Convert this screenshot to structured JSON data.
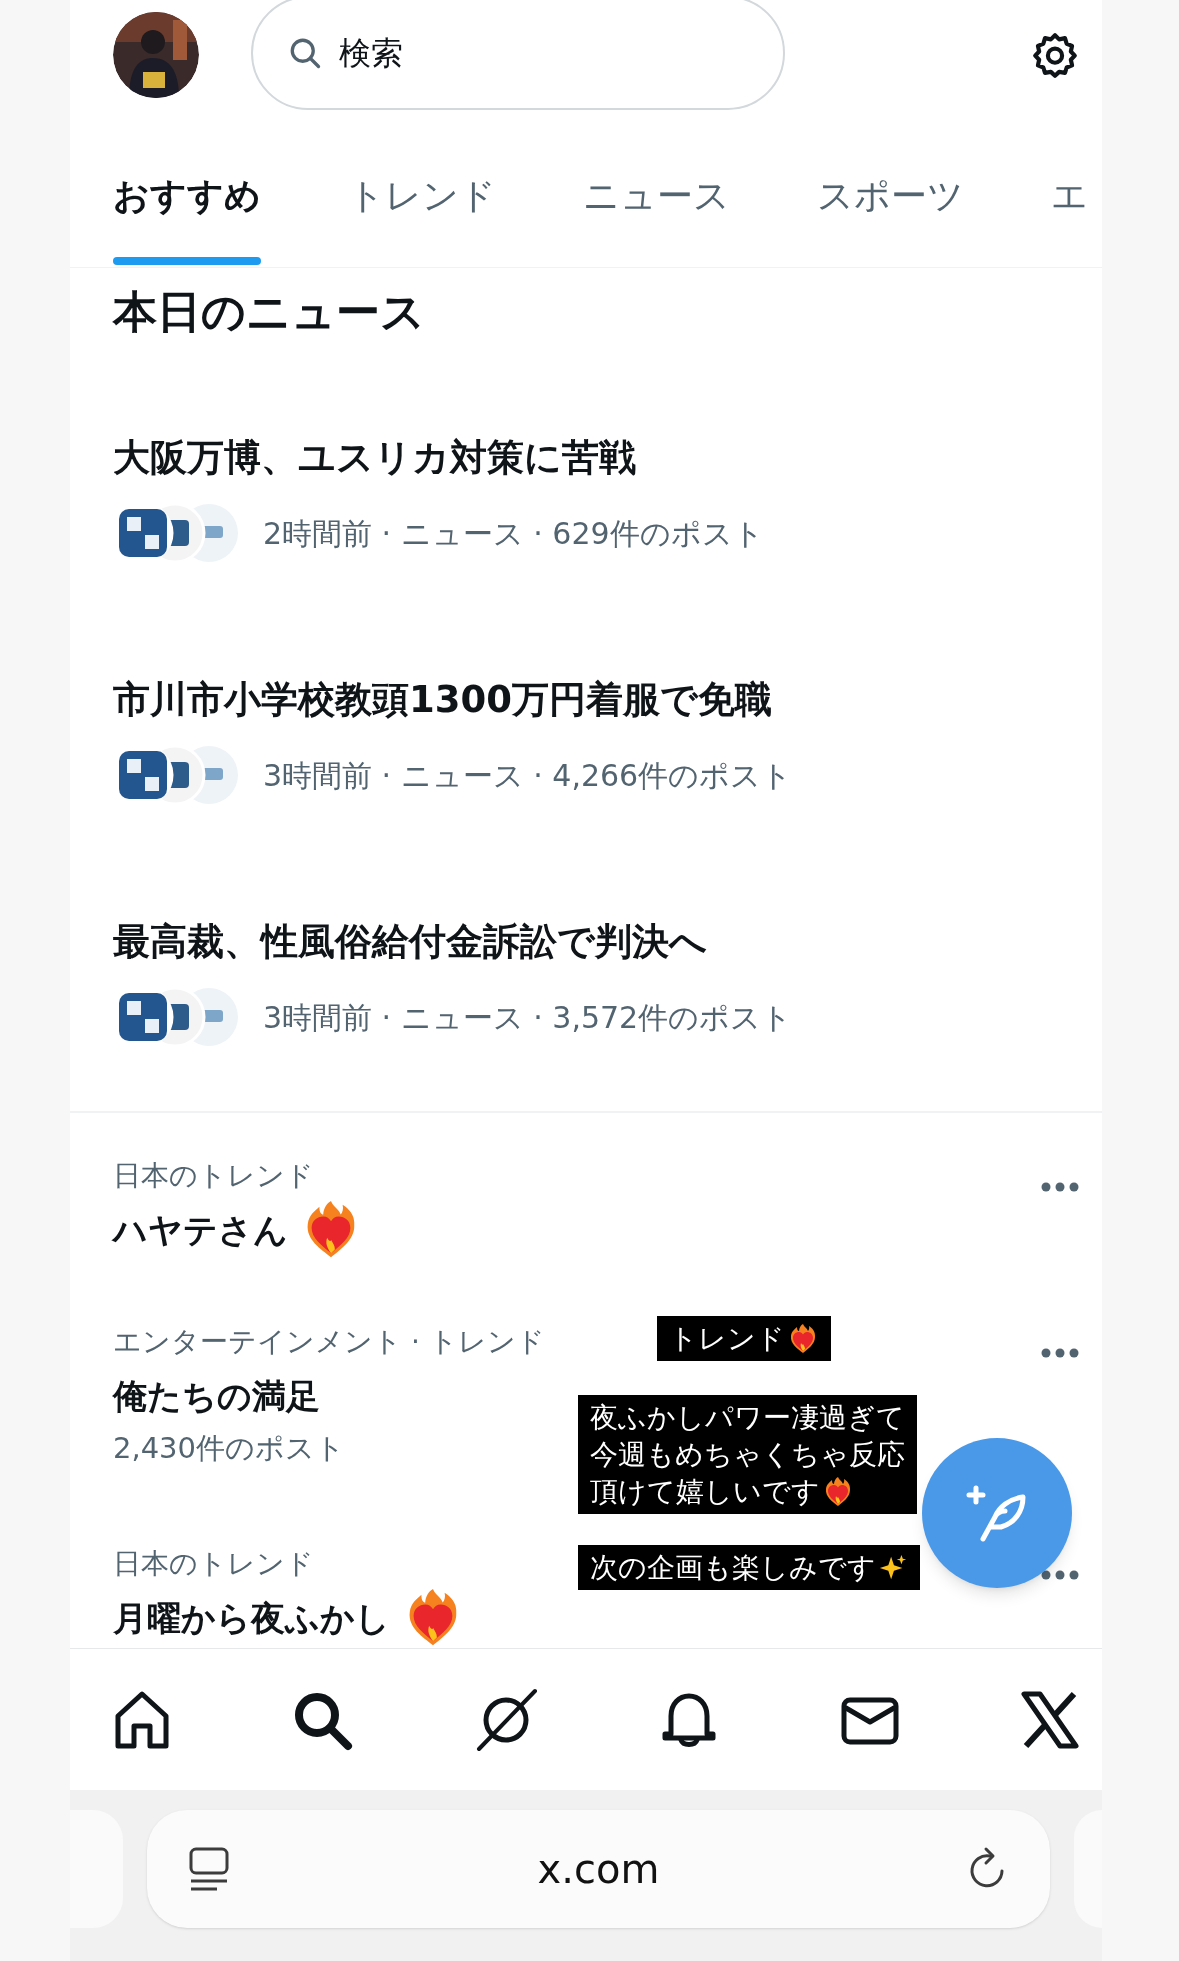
{
  "header": {
    "search": {
      "placeholder": "検索"
    }
  },
  "tabs": [
    {
      "label": "おすすめ",
      "selected": true
    },
    {
      "label": "トレンド",
      "selected": false
    },
    {
      "label": "ニュース",
      "selected": false
    },
    {
      "label": "スポーツ",
      "selected": false
    },
    {
      "label": "エ",
      "selected": false
    }
  ],
  "news": {
    "heading": "本日のニュース",
    "items": [
      {
        "headline": "大阪万博、ユスリカ対策に苦戦",
        "meta": "2時間前 · ニュース · 629件のポスト"
      },
      {
        "headline": "市川市小学校教頭1300万円着服で免職",
        "meta": "3時間前 · ニュース · 4,266件のポスト"
      },
      {
        "headline": "最高裁、性風俗給付金訴訟で判決へ",
        "meta": "3時間前 · ニュース · 3,572件のポスト"
      }
    ]
  },
  "trends": [
    {
      "category": "日本のトレンド",
      "title": "ハヤテさん",
      "fire_heart": true
    },
    {
      "category": "エンターテインメント · トレンド",
      "title": "俺たちの満足",
      "fire_heart": false,
      "posts": "2,430件のポスト"
    },
    {
      "category": "日本のトレンド",
      "title": "月曜から夜ふかし",
      "fire_heart": true
    }
  ],
  "stickers": [
    {
      "lines": [
        "トレンド"
      ],
      "kind": "heart"
    },
    {
      "lines": [
        "夜ふかしパワー凄過ぎて",
        "今週もめちゃくちゃ反応",
        "頂けて嬉しいです"
      ],
      "kind": "heart"
    },
    {
      "lines": [
        "次の企画も楽しみです"
      ],
      "kind": "sparkles"
    }
  ],
  "nav": [
    {
      "kind": "home"
    },
    {
      "kind": "search"
    },
    {
      "kind": "grok"
    },
    {
      "kind": "bell"
    },
    {
      "kind": "mail"
    },
    {
      "kind": "x"
    }
  ],
  "browser": {
    "url": "x.com"
  }
}
